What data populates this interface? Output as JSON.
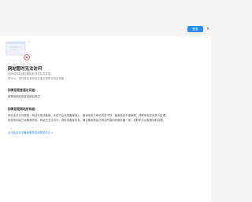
{
  "header": {
    "button_label": "登录",
    "close_label": "✕"
  },
  "error": {
    "title": "网站暂时无法访问",
    "sub1": "该网站未能通过网络检查或存在异常,",
    "sub2": "您可以：重试或检查网络连接后重新访问此页面"
  },
  "section1": {
    "title": "如果您是普通访问者：",
    "text": "请等待网站恢复或稍后再试"
  },
  "section2": {
    "title": "如果您是网站所有者：",
    "line1": "网站无法访问原因：网站未完成备案、未在平台完成备案接入、备案信息与网站内容不符、备案信息不准确等，请联系相关负责人处理。",
    "line2": "如您的网站已经备案完成，网站仍无法访问，请检查备案状态，确认备案信息与网站所指向的服务器一致，或联系平台客服协助处理。"
  },
  "link": {
    "label": "点击此处访问备案服务查询帮助中心 >"
  },
  "colors": {
    "accent": "#2f8ce8",
    "error": "#e84a4a"
  }
}
